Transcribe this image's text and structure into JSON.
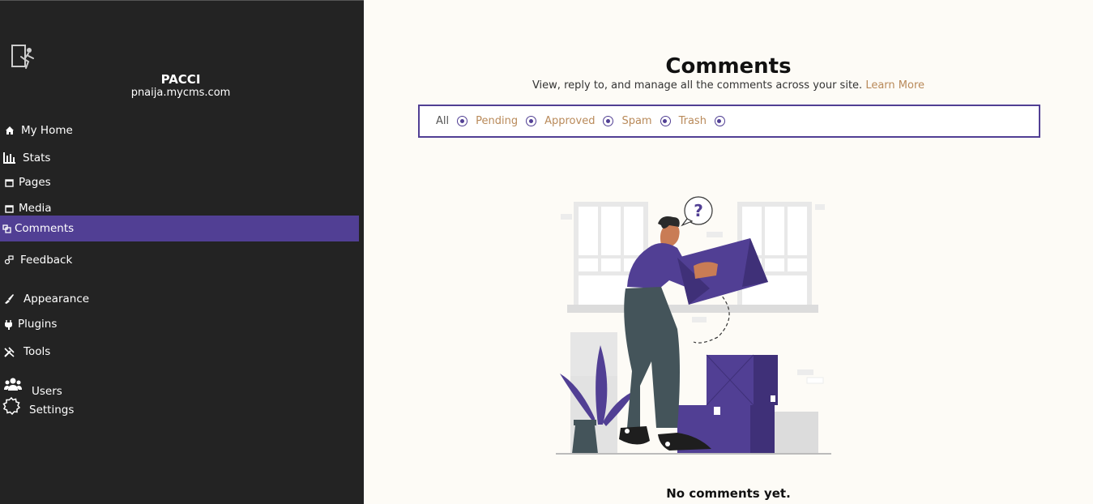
{
  "sidebar": {
    "site_name": "PACCI",
    "site_url": "pnaija.mycms.com",
    "items": [
      {
        "label": "My Home",
        "icon": "home-icon"
      },
      {
        "label": "Stats",
        "icon": "bar-chart-icon"
      },
      {
        "label": "Pages",
        "icon": "page-icon"
      },
      {
        "label": "Media",
        "icon": "media-icon"
      },
      {
        "label": "Comments",
        "icon": "comment-icon",
        "active": true
      },
      {
        "label": "Feedback",
        "icon": "feedback-icon"
      },
      {
        "label": "Appearance",
        "icon": "brush-icon"
      },
      {
        "label": "Plugins",
        "icon": "plug-icon"
      },
      {
        "label": "Tools",
        "icon": "tools-icon"
      },
      {
        "label": "Users",
        "icon": "users-icon"
      },
      {
        "label": "Settings",
        "icon": "gear-icon"
      }
    ]
  },
  "main": {
    "title": "Comments",
    "subtitle": "View, reply to, and manage all the comments across your site.",
    "learn_more": "Learn More",
    "filters": [
      {
        "label": "All"
      },
      {
        "label": "Pending"
      },
      {
        "label": "Approved"
      },
      {
        "label": "Spam"
      },
      {
        "label": "Trash"
      }
    ],
    "empty_message": "No comments yet."
  },
  "colors": {
    "accent": "#513f94",
    "link": "#b98a5a",
    "sidebar_bg": "#232323",
    "page_bg": "#fdfbf6"
  }
}
